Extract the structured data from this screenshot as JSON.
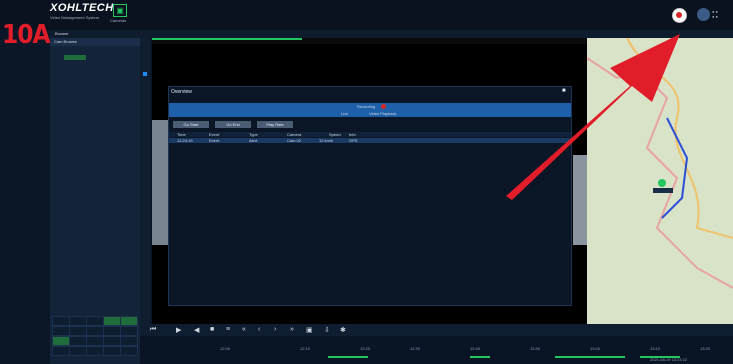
{
  "step_label": "10A.",
  "header": {
    "logo": "XOHLTECH",
    "logo_sub": "Video Management System",
    "camera_label": "Cameras"
  },
  "tabs": {
    "main": "Browse"
  },
  "left_panel": {
    "head": "Cam Browse",
    "chip": "Camera"
  },
  "modal": {
    "title": "Overview",
    "status": "Recording",
    "tab_left": "Live",
    "tab_right": "Video Playback",
    "buttons": [
      "Go Start",
      "Go End",
      "Play Rate"
    ],
    "columns": [
      "Time",
      "Event",
      "Type",
      "Camera",
      "Speed",
      "Info"
    ],
    "row": [
      "12:24:15",
      "Event",
      "Alert",
      "Cam 02",
      "12 km/h",
      "GPS"
    ]
  },
  "timeline": {
    "labels": [
      "12:00",
      "12:10",
      "12:20",
      "12:30",
      "12:40",
      "12:50",
      "13:00",
      "13:10",
      "13:20"
    ],
    "date": "2021-08-19 13:24:22"
  },
  "colors": {
    "accent": "#22c55e",
    "pointer_arrow": "#e11d2a",
    "highlight": "#1d5fa8"
  }
}
